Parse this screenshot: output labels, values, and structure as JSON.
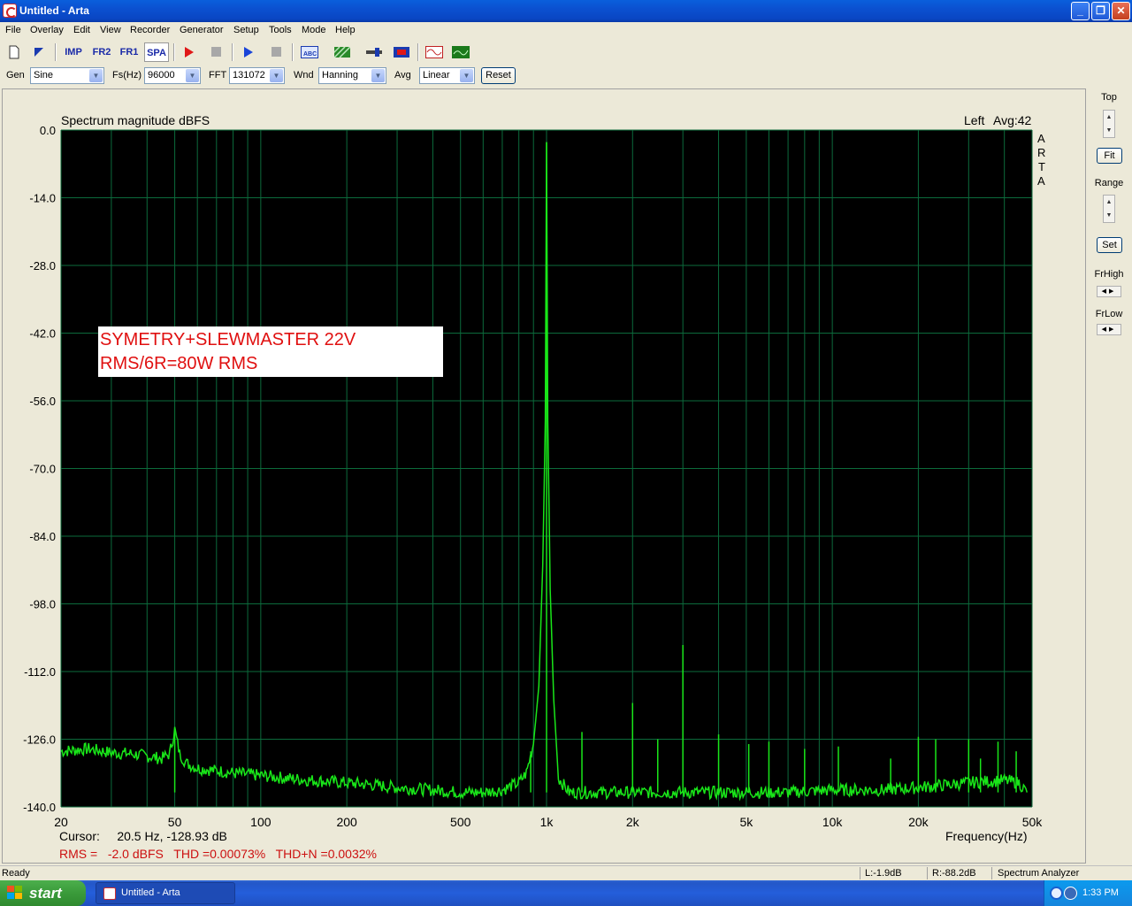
{
  "window": {
    "title": "Untitled - Arta",
    "buttons": {
      "minimize": "_",
      "maximize": "❐",
      "close": "✕"
    }
  },
  "menu": [
    "File",
    "Overlay",
    "Edit",
    "View",
    "Recorder",
    "Generator",
    "Setup",
    "Tools",
    "Mode",
    "Help"
  ],
  "toolbar": {
    "imp": "IMP",
    "fr2": "FR2",
    "fr1": "FR1",
    "spa": "SPA"
  },
  "controls": {
    "gen_label": "Gen",
    "gen_value": "Sine",
    "fs_label": "Fs(Hz)",
    "fs_value": "96000",
    "fft_label": "FFT",
    "fft_value": "131072",
    "wnd_label": "Wnd",
    "wnd_value": "Hanning",
    "avg_label": "Avg",
    "avg_value": "Linear",
    "reset_label": "Reset"
  },
  "right_panel": {
    "top_label": "Top",
    "fit_label": "Fit",
    "range_label": "Range",
    "set_label": "Set",
    "frhigh_label": "FrHigh",
    "frlow_label": "FrLow"
  },
  "chart_header": {
    "title": "Spectrum magnitude dBFS",
    "channel": "Left",
    "avg": "Avg:42",
    "brand": [
      "A",
      "R",
      "T",
      "A"
    ]
  },
  "annotation": {
    "line1": "SYMETRY+SLEWMASTER 22V",
    "line2": "RMS/6R=80W RMS"
  },
  "readouts": {
    "cursor": "Cursor:     20.5 Hz, -128.93 dB",
    "results": "RMS =   -2.0 dBFS   THD =0.00073%   THD+N =0.0032%",
    "xlabel": "Frequency(Hz)"
  },
  "colors": {
    "plot_bg": "#000000",
    "grid": "#0c6b3c",
    "trace": "#19e619",
    "annotation_text": "#e01010",
    "results_text": "#cc1010"
  },
  "chart_data": {
    "type": "line",
    "title": "Spectrum magnitude dBFS",
    "xlabel": "Frequency(Hz)",
    "ylabel": "",
    "x_scale": "log",
    "xlim": [
      20,
      50000
    ],
    "ylim": [
      -140,
      0
    ],
    "x_ticks": [
      20,
      50,
      100,
      200,
      500,
      1000,
      2000,
      5000,
      10000,
      20000,
      50000
    ],
    "x_tick_labels": [
      "20",
      "50",
      "100",
      "200",
      "500",
      "1k",
      "2k",
      "5k",
      "10k",
      "20k",
      "50k"
    ],
    "y_ticks": [
      0,
      -14,
      -28,
      -42,
      -56,
      -70,
      -84,
      -98,
      -112,
      -126,
      -140
    ],
    "y_tick_labels": [
      "0.0",
      "-14.0",
      "-28.0",
      "-42.0",
      "-56.0",
      "-70.0",
      "-84.0",
      "-98.0",
      "-112.0",
      "-126.0",
      "-140.0"
    ],
    "grid": true,
    "series": [
      {
        "x": [
          20,
          25,
          30,
          35,
          40,
          45,
          48,
          50,
          52,
          55,
          60,
          70,
          80,
          100,
          120,
          150,
          200,
          250,
          300,
          400,
          500,
          600,
          700,
          800,
          850,
          900,
          940,
          970,
          990,
          1000,
          1010,
          1030,
          1060,
          1100,
          1200,
          1500,
          2000,
          2500,
          3000,
          4000,
          5000,
          7000,
          10000,
          15000,
          20000,
          30000,
          40000,
          45000,
          48000
        ],
        "y": [
          -128.5,
          -128,
          -128.8,
          -129,
          -129.5,
          -130,
          -129,
          -124,
          -129,
          -131,
          -132,
          -132.5,
          -133,
          -133.5,
          -134,
          -134.5,
          -135,
          -135.5,
          -136,
          -136.5,
          -137,
          -137,
          -136.5,
          -135,
          -133,
          -127,
          -115,
          -90,
          -60,
          -2.5,
          -60,
          -95,
          -118,
          -134,
          -137,
          -137,
          -137,
          -137,
          -137,
          -137,
          -137,
          -137,
          -136.5,
          -136.5,
          -136,
          -135,
          -134.5,
          -135,
          -137
        ]
      }
    ],
    "spikes": [
      {
        "x": 50,
        "y": -124
      },
      {
        "x": 880,
        "y": -128.5
      },
      {
        "x": 1000,
        "y": -2.5
      },
      {
        "x": 1330,
        "y": -124.5
      },
      {
        "x": 2000,
        "y": -118.5
      },
      {
        "x": 2450,
        "y": -126
      },
      {
        "x": 3000,
        "y": -106.5
      },
      {
        "x": 4000,
        "y": -125
      },
      {
        "x": 5100,
        "y": -127
      },
      {
        "x": 6000,
        "y": -126.5
      },
      {
        "x": 8000,
        "y": -128
      },
      {
        "x": 10500,
        "y": -127.5
      },
      {
        "x": 16000,
        "y": -130
      },
      {
        "x": 20000,
        "y": -125.5
      },
      {
        "x": 23000,
        "y": -126
      },
      {
        "x": 30000,
        "y": -126
      },
      {
        "x": 33000,
        "y": -130
      },
      {
        "x": 38000,
        "y": -126.5
      },
      {
        "x": 44000,
        "y": -128.5
      }
    ]
  },
  "status": {
    "left": "Ready",
    "l_level": "L:-1.9dB",
    "r_level": "R:-88.2dB",
    "mode": "Spectrum Analyzer"
  },
  "taskbar": {
    "start": "start",
    "task": "Untitled - Arta",
    "clock": "1:33 PM"
  }
}
